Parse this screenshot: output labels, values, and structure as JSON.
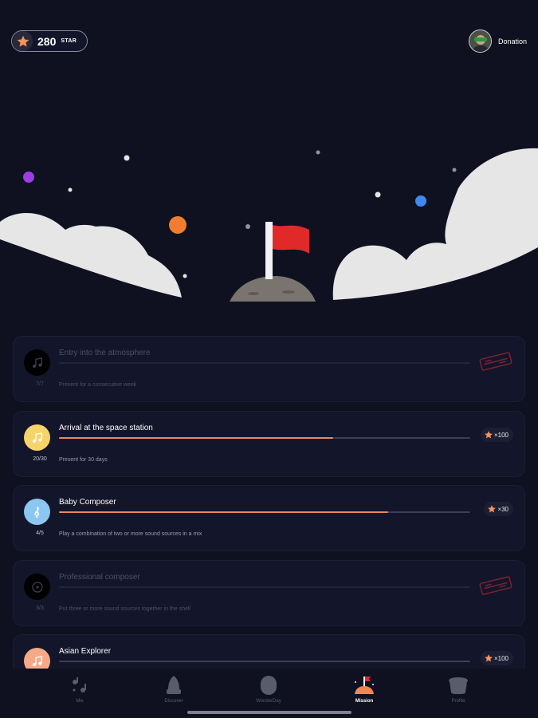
{
  "header": {
    "star_count": "280",
    "star_unit": "STAR",
    "donation_label": "Donation"
  },
  "missions": [
    {
      "title": "Entry into the atmosphere",
      "progress": "7/7",
      "description": "Present for a consecutive week",
      "fraction": 1.0,
      "status": "completed",
      "icon": "music-note-icon",
      "icon_color": "#000000"
    },
    {
      "title": "Arrival at the space station",
      "progress": "20/30",
      "description": "Present for 30 days",
      "fraction": 0.667,
      "status": "active",
      "reward": "×100",
      "icon": "music-note-icon",
      "icon_color": "#f7d36b"
    },
    {
      "title": "Baby Composer",
      "progress": "4/5",
      "description": "Play a combination of two or more sound sources in a mix",
      "fraction": 0.8,
      "status": "active",
      "reward": "×30",
      "icon": "treble-clef-icon",
      "icon_color": "#8cc7f2"
    },
    {
      "title": "Professional composer",
      "progress": "3/3",
      "description": "Put three or more sound sources together in the shell",
      "fraction": 1.0,
      "status": "completed",
      "icon": "record-icon",
      "icon_color": "#000000"
    },
    {
      "title": "Asian Explorer",
      "progress": "",
      "description": "",
      "fraction": 0.0,
      "status": "active",
      "reward": "×100",
      "icon": "music-note-icon",
      "icon_color": "#f7a987"
    }
  ],
  "tabs": [
    {
      "label": "Mix",
      "icon": "music-notes-icon"
    },
    {
      "label": "Discover",
      "icon": "rocket-icon"
    },
    {
      "label": "WonderDay",
      "icon": "capsule-icon"
    },
    {
      "label": "Mission",
      "icon": "mission-flag-icon",
      "active": true
    },
    {
      "label": "Profile",
      "icon": "profile-pot-icon"
    }
  ],
  "colors": {
    "background": "#0f1120",
    "card": "#13152a",
    "accent": "#f08752",
    "flag": "#e02a2a",
    "cloud": "#e6e6e6"
  }
}
